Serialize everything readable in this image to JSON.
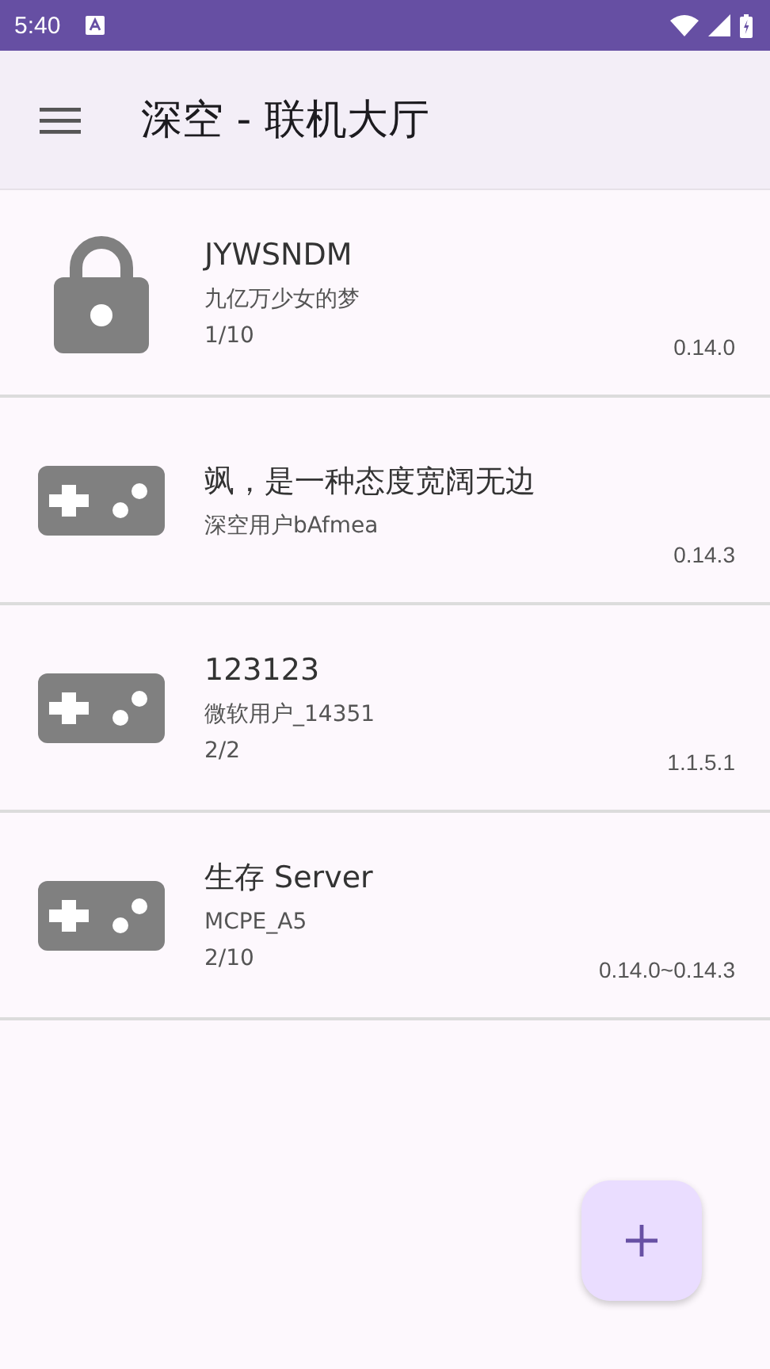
{
  "status_bar": {
    "time": "5:40"
  },
  "app_bar": {
    "title": "深空 - 联机大厅"
  },
  "rooms": [
    {
      "kind": "locked",
      "name": "JYWSNDM",
      "host": "九亿万少女的梦",
      "players": "1/10",
      "version": "0.14.0"
    },
    {
      "kind": "open",
      "name": "飒，是一种态度宽阔无边",
      "host": "深空用户bAfmea",
      "version": "0.14.3"
    },
    {
      "kind": "open",
      "name": "123123",
      "host": "微软用户_14351",
      "players": "2/2",
      "version": "1.1.5.1"
    },
    {
      "kind": "open",
      "name": "生存 Server",
      "host": "MCPE_A5",
      "players": "2/10",
      "version": "0.14.0~0.14.3"
    }
  ]
}
